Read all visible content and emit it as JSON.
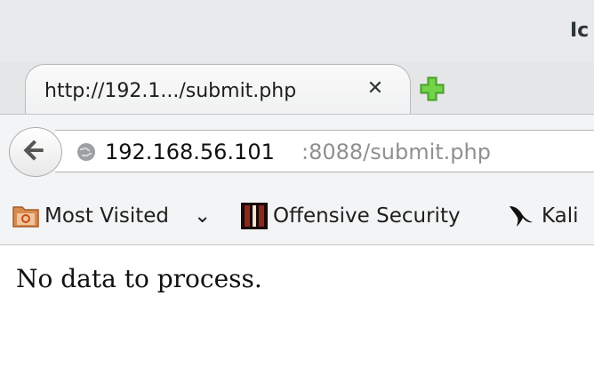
{
  "window": {
    "title": "Ic"
  },
  "tab": {
    "label": "http://192.1.../submit.php",
    "close_symbol": "✕",
    "new_tab_icon": "plus-icon"
  },
  "navbar": {
    "back_icon": "back-arrow-icon",
    "url_host": "192.168.56.101",
    "url_rest": ":8088/submit.php"
  },
  "bookmarks": {
    "items": [
      {
        "label": "Most Visited",
        "icon": "most-visited-folder-icon",
        "has_dropdown": true
      },
      {
        "label": "Offensive Security",
        "icon": "offensive-security-icon"
      },
      {
        "label": "Kali",
        "icon": "kali-dragon-icon"
      }
    ],
    "dropdown_symbol": "⌄"
  },
  "page": {
    "body_text": "No data to process."
  },
  "colors": {
    "chrome_background": "#e9eaec",
    "new_tab_green": "#59b931",
    "url_muted": "#8e9092"
  }
}
